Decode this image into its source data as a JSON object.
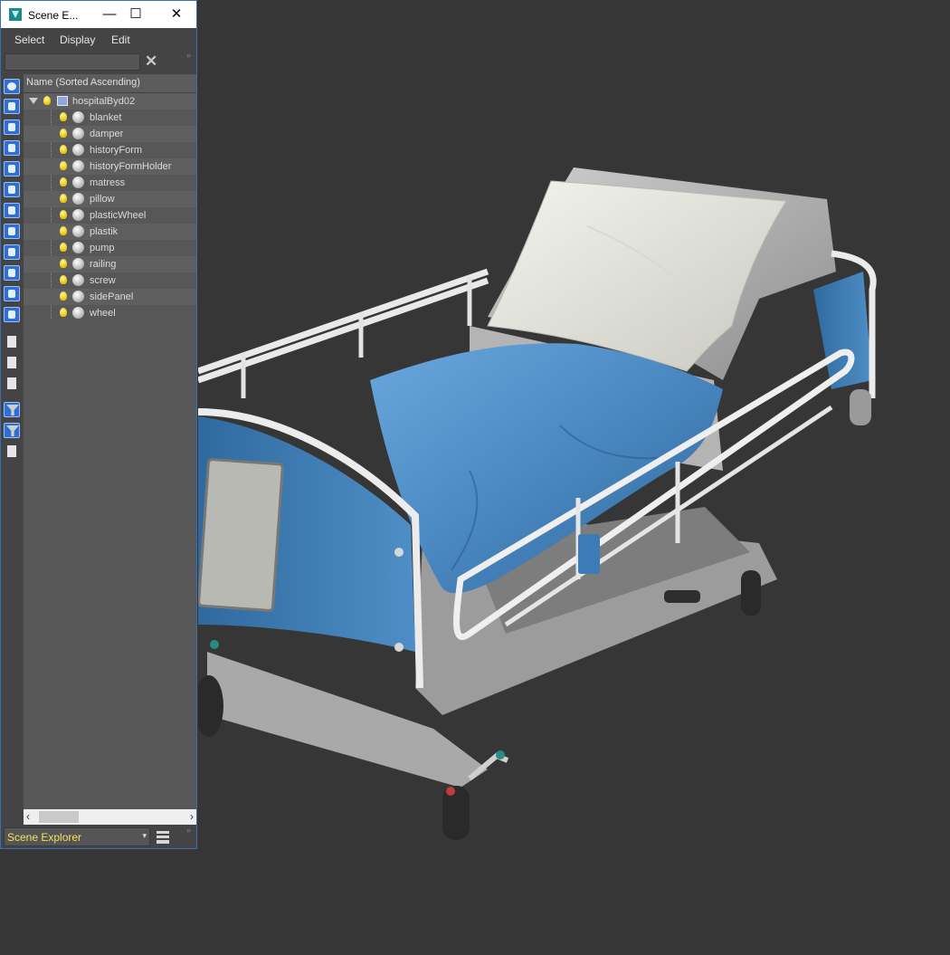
{
  "window": {
    "title": "Scene E...",
    "controls": {
      "minimize": "—",
      "maximize": "☐",
      "close": "✕"
    }
  },
  "menu": [
    "Select",
    "Display",
    "Edit"
  ],
  "search": {
    "value": "",
    "placeholder": "",
    "clear_icon": "✕",
    "more_icon": "»"
  },
  "tree": {
    "header": "Name (Sorted Ascending)",
    "root": "hospitalByd02",
    "children": [
      "blanket",
      "damper",
      "historyForm",
      "historyFormHolder",
      "matress",
      "pillow",
      "plasticWheel",
      "plastik",
      "pump",
      "railing",
      "screw",
      "sidePanel",
      "wheel"
    ]
  },
  "scrollbar": {
    "left": "‹",
    "right": "›"
  },
  "bottom": {
    "explorer": "Scene Explorer",
    "caret": "▾",
    "more_icon": "»"
  },
  "left_tools": [
    "display-none-icon",
    "display-all-icon",
    "display-invert-icon",
    "geometry-filter-icon",
    "shapes-filter-icon",
    "lights-filter-icon",
    "cameras-filter-icon",
    "helpers-filter-icon",
    "spacewarps-filter-icon",
    "groups-filter-icon",
    "xrefs-filter-icon",
    "bones-filter-icon",
    "list-view-icon",
    "page-icon",
    "details-icon",
    "filter-icon",
    "filter-options-icon",
    "layer-display-icon"
  ],
  "colors": {
    "viewport_bg": "#363636",
    "panel_bg": "#444444",
    "selection_text": "#f2e25a",
    "accent_blue": "#2e6fd6",
    "blanket_blue": "#4a88c2"
  },
  "viewport": {
    "object": "hospital-bed-3d-model"
  }
}
